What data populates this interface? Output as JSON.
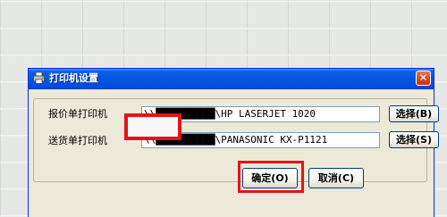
{
  "dialog": {
    "title": "打印机设置",
    "close_glyph": "✕",
    "icons": [
      "printer-icon",
      "close-icon"
    ]
  },
  "rows": [
    {
      "label": "报价单打印机",
      "path": "\\\\██████████\\HP LASERJET 1020",
      "button_label": "选择(B)"
    },
    {
      "label": "送货单打印机",
      "path": "\\\\██████████\\PANASONIC KX-P1121",
      "button_label": "选择(S)"
    }
  ],
  "footer": {
    "ok_label": "确定(O)",
    "cancel_label": "取消(C)"
  },
  "colors": {
    "title_bar": "#0456e0",
    "dialog_bg": "#ece9d8",
    "highlight": "#e3131b",
    "close_button": "#d7421b"
  }
}
